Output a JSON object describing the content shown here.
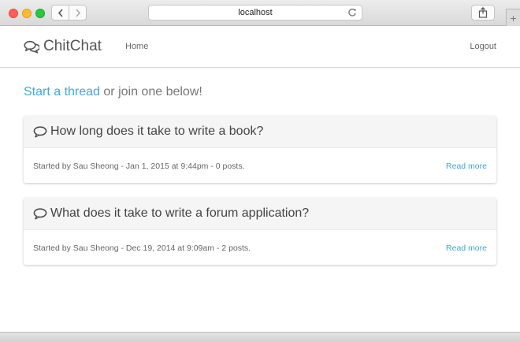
{
  "browser": {
    "url": "localhost",
    "new_tab_label": "+",
    "icons": [
      "back-arrow-icon",
      "forward-arrow-icon",
      "reload-icon",
      "share-icon"
    ]
  },
  "navbar": {
    "brand": "ChitChat",
    "brand_icon": "chat-bubbles-icon",
    "home": "Home",
    "logout": "Logout"
  },
  "intro": {
    "link": "Start a thread",
    "rest": "or join one below!"
  },
  "threads": [
    {
      "title": "How long does it take to write a book?",
      "meta": "Started by Sau Sheong - Jan 1, 2015 at 9:44pm - 0 posts.",
      "read_more": "Read more"
    },
    {
      "title": "What does it take to write a forum application?",
      "meta": "Started by Sau Sheong - Dec 19, 2014 at 9:09am - 2 posts.",
      "read_more": "Read more"
    }
  ],
  "colors": {
    "link": "#3ea7d8",
    "text": "#555555",
    "card_header": "#f5f5f5"
  }
}
